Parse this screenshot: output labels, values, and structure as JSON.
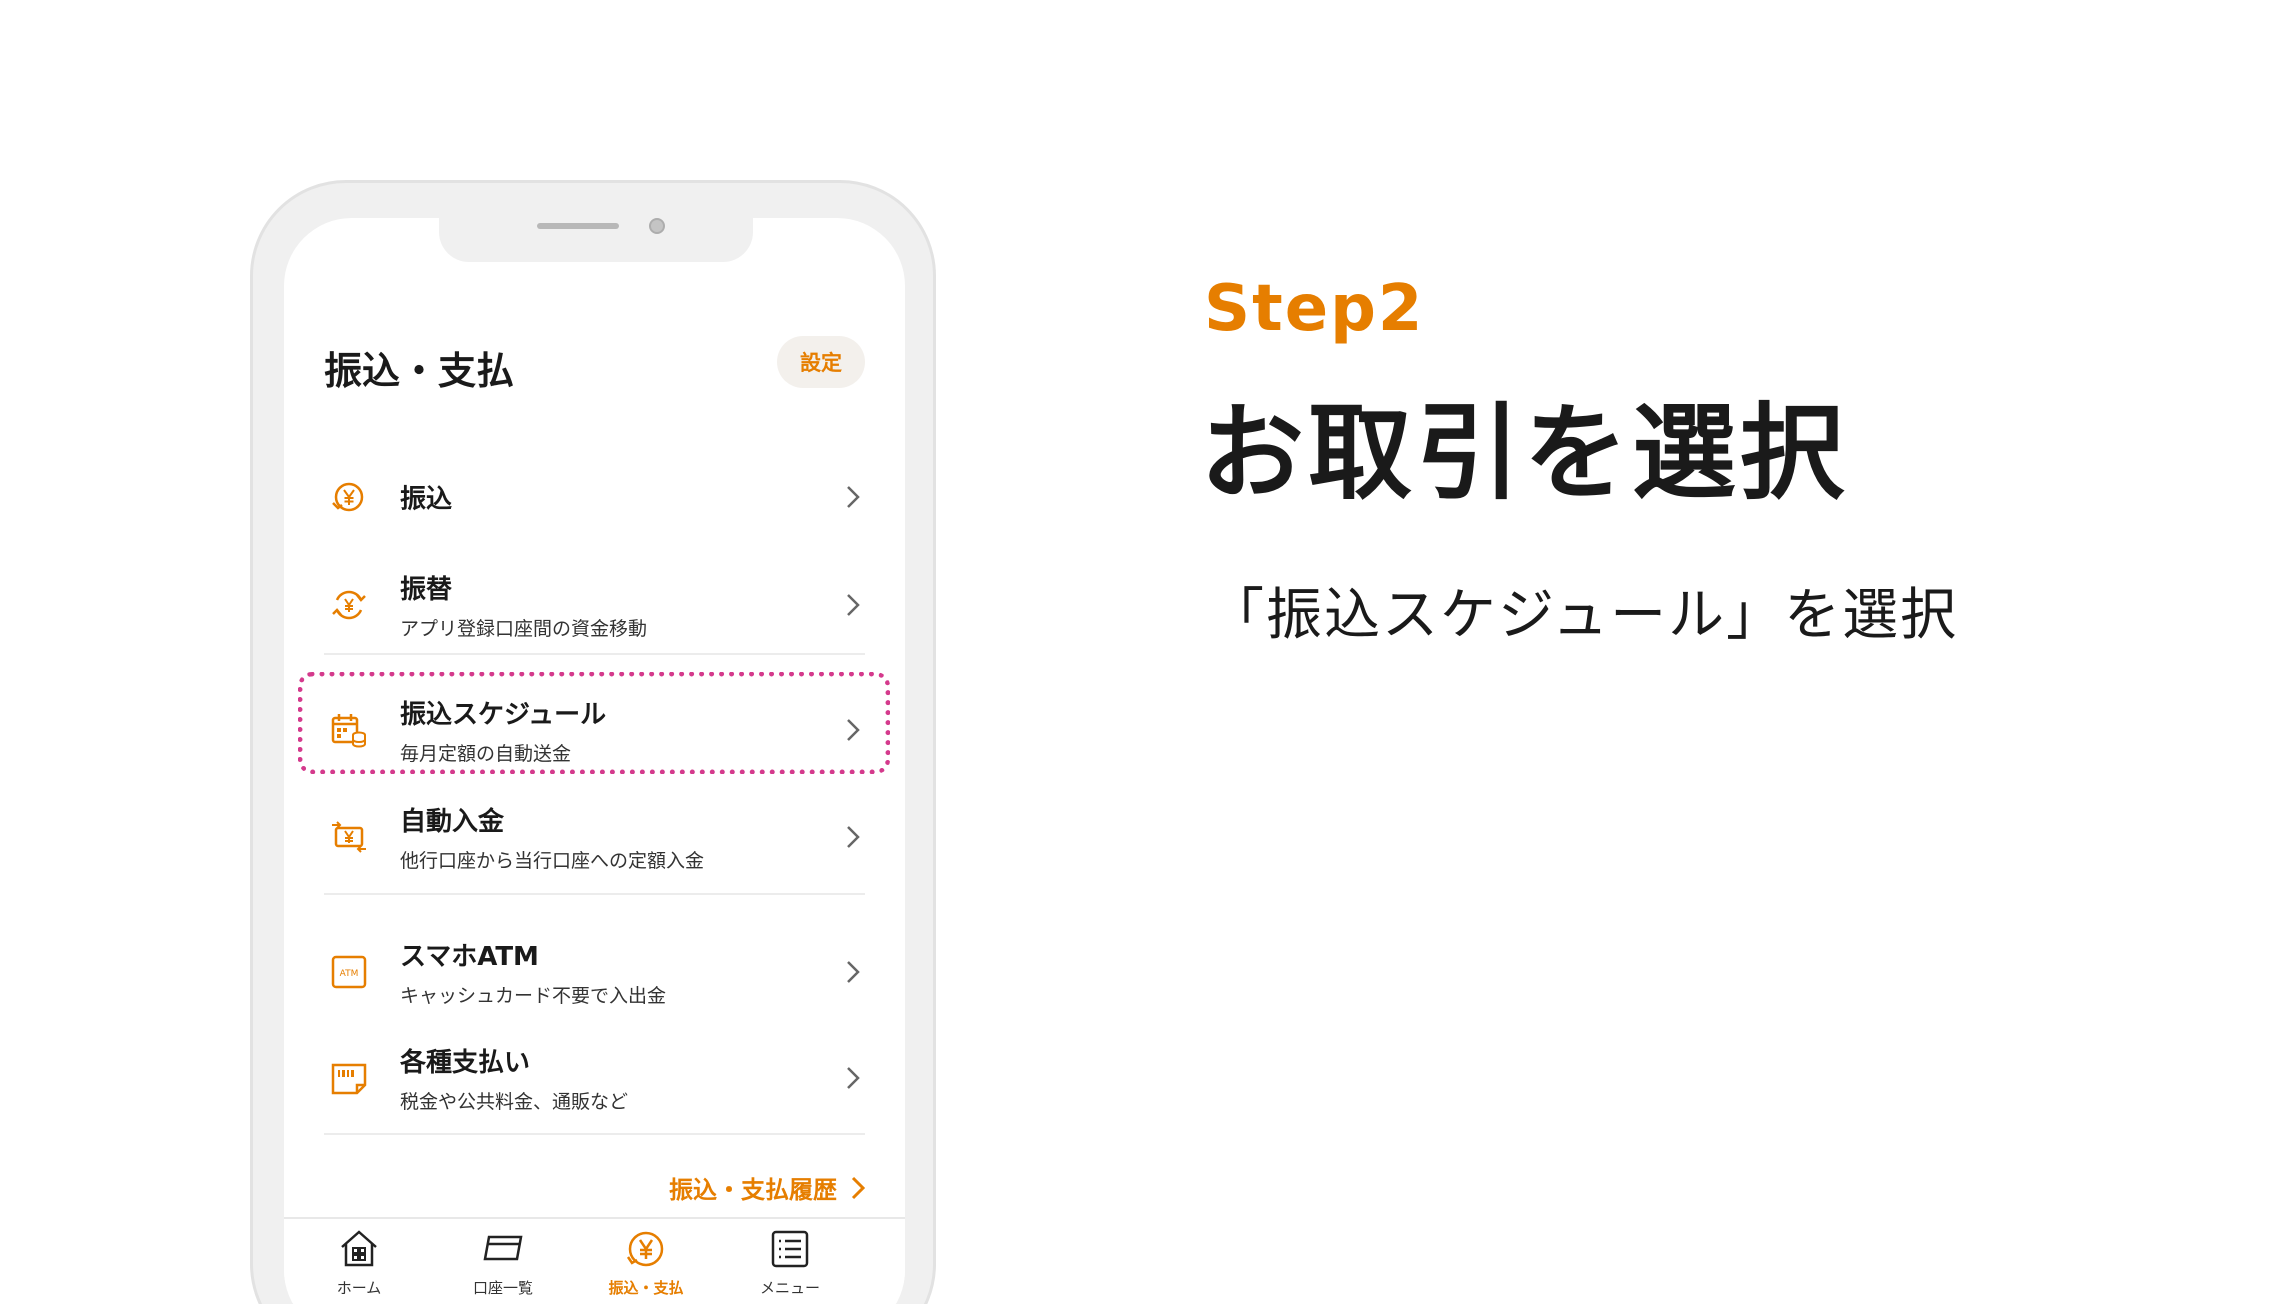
{
  "colors": {
    "accent": "#e67e00",
    "highlight": "#d43a8c",
    "text": "#1a1a1a"
  },
  "app": {
    "title": "振込・支払",
    "settings_label": "設定",
    "menu": [
      {
        "label": "振込",
        "sub": "",
        "icon": "yen-transfer-icon"
      },
      {
        "label": "振替",
        "sub": "アプリ登録口座間の資金移動",
        "icon": "yen-exchange-icon"
      },
      {
        "label": "振込スケジュール",
        "sub": "毎月定額の自動送金",
        "icon": "calendar-coins-icon",
        "highlighted": true
      },
      {
        "label": "自動入金",
        "sub": "他行口座から当行口座への定額入金",
        "icon": "auto-deposit-icon"
      },
      {
        "label": "スマホATM",
        "sub": "キャッシュカード不要で入出金",
        "icon": "atm-icon"
      },
      {
        "label": "各種支払い",
        "sub": "税金や公共料金、通販など",
        "icon": "payment-slip-icon"
      }
    ],
    "history_link": "振込・支払履歴",
    "tabs": [
      {
        "label": "ホーム",
        "icon": "home-icon"
      },
      {
        "label": "口座一覧",
        "icon": "card-icon"
      },
      {
        "label": "振込・支払",
        "icon": "yen-circle-icon",
        "active": true
      },
      {
        "label": "メニュー",
        "icon": "list-icon"
      }
    ]
  },
  "instruction": {
    "step": "Step2",
    "heading": "お取引を選択",
    "description": "「振込スケジュール」を選択"
  }
}
